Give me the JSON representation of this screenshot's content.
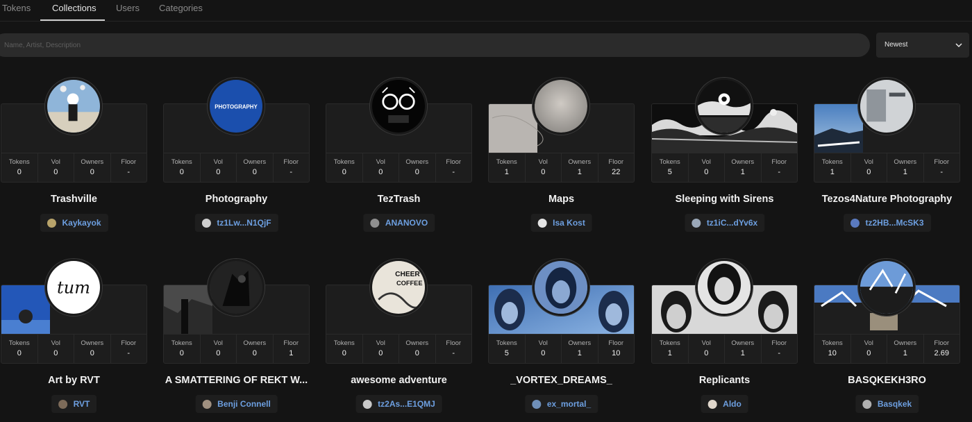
{
  "tabs": [
    {
      "label": "Tokens",
      "active": false
    },
    {
      "label": "Collections",
      "active": true
    },
    {
      "label": "Users",
      "active": false
    },
    {
      "label": "Categories",
      "active": false
    }
  ],
  "search": {
    "placeholder": "Name, Artist, Description",
    "value": ""
  },
  "sort": {
    "selected": "Newest"
  },
  "stat_labels": {
    "tokens": "Tokens",
    "vol": "Vol",
    "owners": "Owners",
    "floor": "Floor"
  },
  "collections": [
    {
      "title": "Trashville",
      "creator": "Kaykayok",
      "tokens": "0",
      "vol": "0",
      "owners": "0",
      "floor": "-"
    },
    {
      "title": "Photography",
      "creator": "tz1Lw...N1QjF",
      "avatar_text": "PHOTOGRAPHY",
      "tokens": "0",
      "vol": "0",
      "owners": "0",
      "floor": "-"
    },
    {
      "title": "TezTrash",
      "creator": "ANANOVO",
      "tokens": "0",
      "vol": "0",
      "owners": "0",
      "floor": "-"
    },
    {
      "title": "Maps",
      "creator": "Isa Kost",
      "tokens": "1",
      "vol": "0",
      "owners": "1",
      "floor": "22"
    },
    {
      "title": "Sleeping with Sirens",
      "creator": "tz1iC...dYv6x",
      "tokens": "5",
      "vol": "0",
      "owners": "1",
      "floor": "-"
    },
    {
      "title": "Tezos4Nature Photography",
      "creator": "tz2HB...McSK3",
      "tokens": "1",
      "vol": "0",
      "owners": "1",
      "floor": "-"
    },
    {
      "title": "Art by RVT",
      "creator": "RVT",
      "avatar_text": "tum",
      "tokens": "0",
      "vol": "0",
      "owners": "0",
      "floor": "-"
    },
    {
      "title": "A SMATTERING OF REKT W...",
      "creator": "Benji Connell",
      "tokens": "0",
      "vol": "0",
      "owners": "0",
      "floor": "1"
    },
    {
      "title": "awesome adventure",
      "creator": "tz2As...E1QMJ",
      "avatar_text": "CHEER COFFEE",
      "tokens": "0",
      "vol": "0",
      "owners": "0",
      "floor": "-"
    },
    {
      "title": "_VORTEX_DREAMS_",
      "creator": "ex_mortal_",
      "tokens": "5",
      "vol": "0",
      "owners": "1",
      "floor": "10"
    },
    {
      "title": "Replicants",
      "creator": "Aldo",
      "tokens": "1",
      "vol": "0",
      "owners": "1",
      "floor": "-"
    },
    {
      "title": "BASQKEKH3RO",
      "creator": "Basqkek",
      "tokens": "10",
      "vol": "0",
      "owners": "1",
      "floor": "2.69"
    }
  ],
  "colors": {
    "background": "#141414",
    "link": "#6d9fe0",
    "panel": "#1d1d1d"
  }
}
